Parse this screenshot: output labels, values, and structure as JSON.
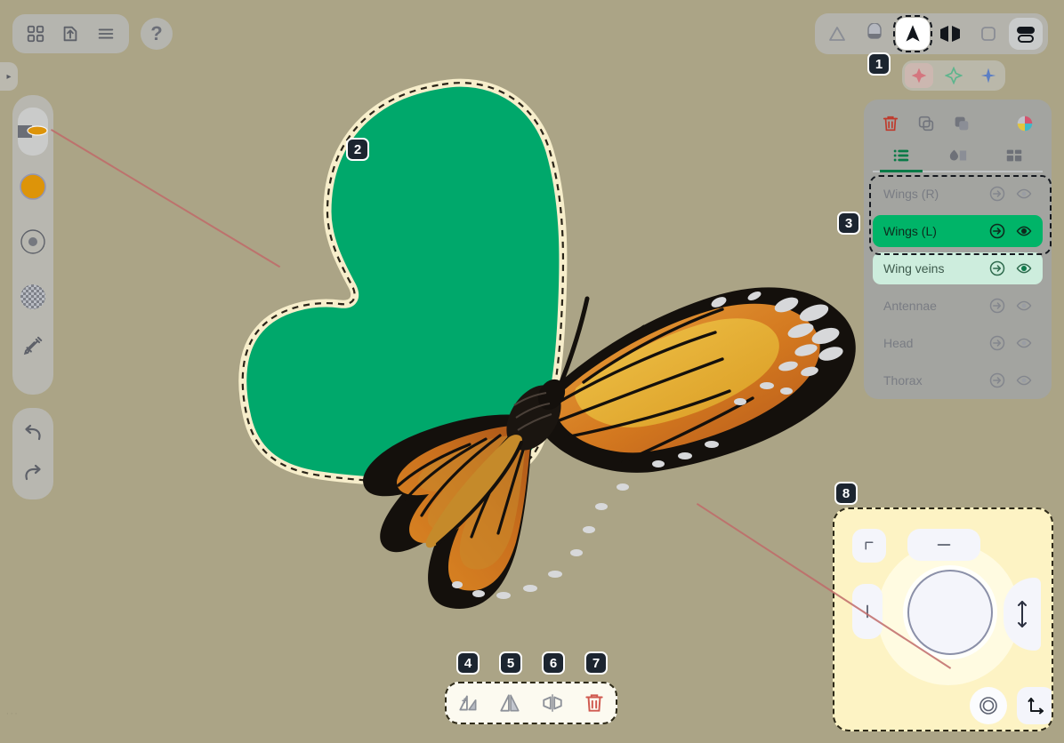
{
  "app": {
    "canvas_background": "#aba486",
    "accent_green": "#00b468",
    "accent_green_light": "#cdeddd",
    "selection_dash": "#15191f",
    "guide_line_color": "#c06a68"
  },
  "badges": [
    {
      "id": "1",
      "label": "1",
      "target": "top-right-toolbar-move-tool"
    },
    {
      "id": "2",
      "label": "2",
      "target": "canvas-selected-shape"
    },
    {
      "id": "3",
      "label": "3",
      "target": "layers-selection-group"
    },
    {
      "id": "4",
      "label": "4",
      "target": "flip-add-button"
    },
    {
      "id": "5",
      "label": "5",
      "target": "flip-horizontal-button"
    },
    {
      "id": "6",
      "label": "6",
      "target": "mirror-button"
    },
    {
      "id": "7",
      "label": "7",
      "target": "delete-selection-button"
    },
    {
      "id": "8",
      "label": "8",
      "target": "transform-gizmo-panel"
    }
  ],
  "topleft_toolbar": {
    "items": [
      {
        "name": "gallery-grid-button",
        "icon": "grid-icon",
        "label": "Gallery"
      },
      {
        "name": "export-button",
        "icon": "export-upload-icon",
        "label": "Export"
      },
      {
        "name": "menu-button",
        "icon": "hamburger-menu-icon",
        "label": "Menu"
      }
    ],
    "help": {
      "name": "help-button",
      "icon": "question-mark-icon",
      "label": "?"
    }
  },
  "left_rail": {
    "handle": {
      "name": "panel-collapse-handle",
      "icon": "chevron-right-icon",
      "label": "▸"
    },
    "tools": [
      {
        "name": "brush-preset-tool",
        "icon": "brush-stroke-icon",
        "label": "Brush",
        "active": true
      },
      {
        "name": "color-swatch-tool",
        "icon": "color-circle-icon",
        "label": "Color",
        "color": "#dd9409"
      },
      {
        "name": "brush-size-tool",
        "icon": "dot-size-icon",
        "label": "Size"
      },
      {
        "name": "opacity-tool",
        "icon": "checkerboard-icon",
        "label": "Opacity"
      },
      {
        "name": "eyedropper-tool",
        "icon": "eyedropper-icon",
        "label": "Eyedropper"
      }
    ],
    "history": [
      {
        "name": "undo-button",
        "icon": "undo-arrow-icon",
        "label": "Undo"
      },
      {
        "name": "redo-button",
        "icon": "redo-arrow-icon",
        "label": "Redo"
      }
    ]
  },
  "topright_toolbar": {
    "items": [
      {
        "name": "shape-outline-tool",
        "icon": "triangle-outline-icon",
        "label": "Shape",
        "state": "default"
      },
      {
        "name": "fill-tool",
        "icon": "fill-bucket-icon",
        "label": "Fill",
        "state": "default"
      },
      {
        "name": "move-tool",
        "icon": "cursor-arrow-icon",
        "label": "Move",
        "state": "selected"
      },
      {
        "name": "mirror-tool",
        "icon": "mirror-icon",
        "label": "Mirror",
        "state": "default"
      },
      {
        "name": "canvas-tool",
        "icon": "rounded-square-outline-icon",
        "label": "Canvas",
        "state": "default"
      },
      {
        "name": "layers-toggle",
        "icon": "stacked-pills-icon",
        "label": "Layers",
        "state": "soft"
      }
    ]
  },
  "sticker_row": {
    "items": [
      {
        "name": "sticker-pink",
        "icon": "sparkle-star-icon",
        "color": "#d4767f",
        "active": true
      },
      {
        "name": "sticker-green",
        "icon": "sparkle-star-icon",
        "color": "#5db58d",
        "active": false
      },
      {
        "name": "sticker-blue",
        "icon": "sparkle-diamond-icon",
        "color": "#5b7ec4",
        "active": false
      }
    ]
  },
  "layers_panel": {
    "actions": [
      {
        "name": "delete-layer-button",
        "icon": "trash-icon",
        "label": "Delete",
        "color": "#c0392b"
      },
      {
        "name": "duplicate-layer-button",
        "icon": "duplicate-icon",
        "label": "Duplicate",
        "color": "#6e7178"
      },
      {
        "name": "merge-layers-button",
        "icon": "merge-shapes-icon",
        "label": "Merge",
        "color": "#6e7178"
      },
      {
        "name": "color-wheel-button",
        "icon": "color-wheel-icon",
        "label": "Colors",
        "color": "#d06a8a"
      }
    ],
    "tabs": [
      {
        "name": "tab-layers",
        "icon": "list-lines-icon",
        "label": "Layers",
        "active": true
      },
      {
        "name": "tab-shapes",
        "icon": "shapes-icon",
        "label": "Shapes",
        "active": false
      },
      {
        "name": "tab-assets",
        "icon": "grid-blocks-icon",
        "label": "Assets",
        "active": false
      }
    ],
    "layers": [
      {
        "name": "layer-row-wings-r",
        "label": "Wings (R)",
        "state": "normal",
        "isolate_icon": "isolate-arrow-icon",
        "visibility_icon": "eye-icon",
        "visible": true
      },
      {
        "name": "layer-row-wings-l",
        "label": "Wings (L)",
        "state": "selected-primary",
        "isolate_icon": "isolate-arrow-icon",
        "visibility_icon": "eye-icon",
        "visible": true
      },
      {
        "name": "layer-row-wing-veins",
        "label": "Wing veins",
        "state": "selected-secondary",
        "isolate_icon": "isolate-arrow-icon",
        "visibility_icon": "eye-icon",
        "visible": true
      },
      {
        "name": "layer-row-antennae",
        "label": "Antennae",
        "state": "normal",
        "isolate_icon": "isolate-arrow-icon",
        "visibility_icon": "eye-icon",
        "visible": true
      },
      {
        "name": "layer-row-head",
        "label": "Head",
        "state": "normal",
        "isolate_icon": "isolate-arrow-icon",
        "visibility_icon": "eye-icon",
        "visible": true
      },
      {
        "name": "layer-row-thorax",
        "label": "Thorax",
        "state": "normal",
        "isolate_icon": "isolate-arrow-icon",
        "visibility_icon": "eye-icon",
        "visible": true
      }
    ]
  },
  "bottom_toolbar": {
    "items": [
      {
        "name": "flip-add-button",
        "icon": "flip-add-icon",
        "label": "Flip & Add",
        "color": "#8d9199"
      },
      {
        "name": "flip-horizontal-button",
        "icon": "flip-horizontal-icon",
        "label": "Flip Horizontal",
        "color": "#8d9199"
      },
      {
        "name": "mirror-button",
        "icon": "mirror-join-icon",
        "label": "Mirror",
        "color": "#8d9199"
      },
      {
        "name": "delete-selection-button",
        "icon": "trash-icon",
        "label": "Delete",
        "color": "#d0594f"
      }
    ]
  },
  "transform_gizmo": {
    "controls": [
      {
        "name": "corner-snap-button",
        "icon": "corner-bracket-icon",
        "label": "Corner"
      },
      {
        "name": "horizontal-scale-button",
        "icon": "horizontal-dash-icon",
        "label": "Horizontal"
      },
      {
        "name": "vertical-scale-button",
        "icon": "vertical-bar-icon",
        "label": "Vertical"
      },
      {
        "name": "flip-vertical-arc-button",
        "icon": "up-down-arrow-icon",
        "label": "Flip Vertical"
      },
      {
        "name": "rotate-dial",
        "icon": "rotation-dial-icon",
        "label": "Rotate"
      },
      {
        "name": "reset-pivot-button",
        "icon": "concentric-circles-icon",
        "label": "Pivot"
      },
      {
        "name": "axes-transform-button",
        "icon": "axes-arrow-icon",
        "label": "Axes"
      }
    ]
  },
  "canvas": {
    "selected_shape": {
      "name": "canvas-selected-shape",
      "label": "Wings (L)",
      "fill": "#00a86b",
      "stroke": "#f7eecb",
      "dash": "#2a2418"
    },
    "artwork_title": "Monarch butterfly illustration"
  },
  "watermark": {
    "label": "···"
  }
}
